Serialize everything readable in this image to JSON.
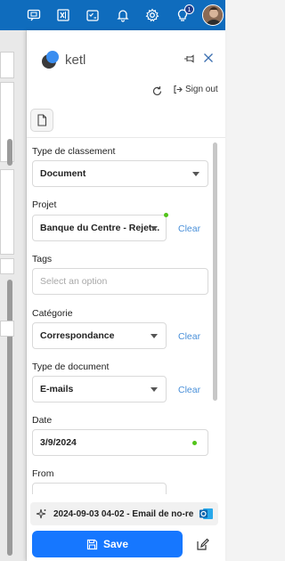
{
  "app": {
    "name": "ketl"
  },
  "header": {
    "sign_out_label": "Sign out"
  },
  "topbar": {
    "notification_count": "1"
  },
  "form": {
    "type_classement": {
      "label": "Type de classement",
      "value": "Document"
    },
    "projet": {
      "label": "Projet",
      "value": "Banque du Centre - Rejet...",
      "clear_label": "Clear"
    },
    "tags": {
      "label": "Tags",
      "placeholder": "Select an option"
    },
    "categorie": {
      "label": "Catégorie",
      "value": "Correspondance",
      "clear_label": "Clear"
    },
    "type_document": {
      "label": "Type de document",
      "value": "E-mails",
      "clear_label": "Clear"
    },
    "date": {
      "label": "Date",
      "value": "3/9/2024"
    },
    "from": {
      "label": "From"
    }
  },
  "email": {
    "subject": "2024-09-03 04-02 - Email de no-re"
  },
  "actions": {
    "save_label": "Save"
  },
  "colors": {
    "accent": "#1677ff",
    "outlook_bar": "#0f6cbd",
    "valid": "#52c41a",
    "link": "#4a90d9"
  }
}
